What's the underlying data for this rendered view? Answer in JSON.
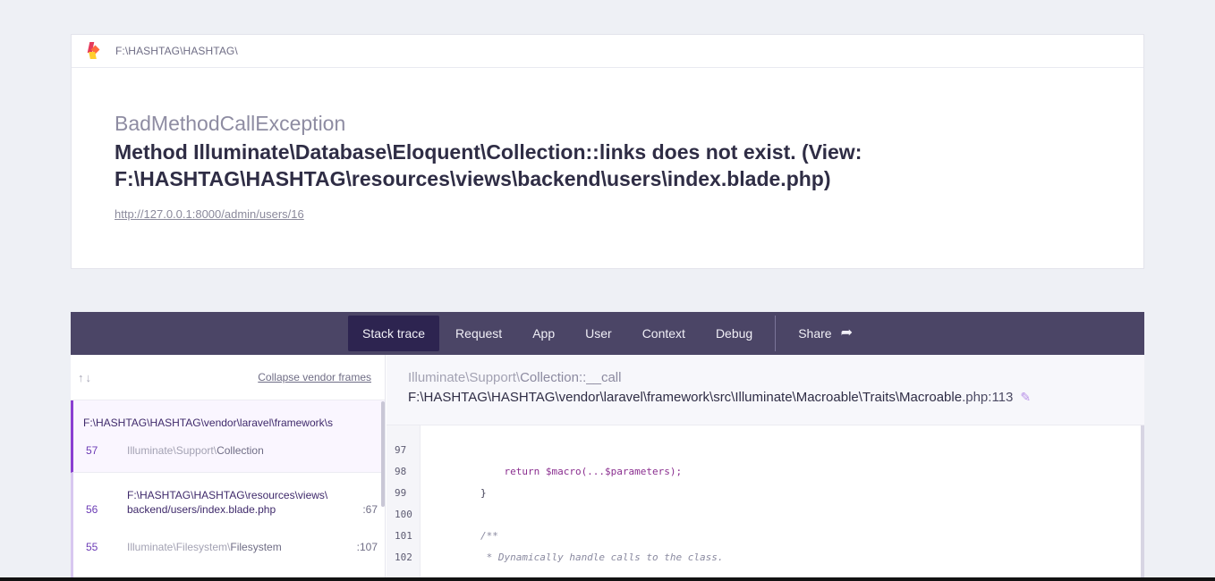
{
  "header": {
    "app_path": "F:\\HASHTAG\\HASHTAG\\",
    "exception_class": "BadMethodCallException",
    "exception_message": "Method Illuminate\\Database\\Eloquent\\Collection::links does not exist. (View: F:\\HASHTAG\\HASHTAG\\resources\\views\\backend\\users\\index.blade.php)",
    "url": "http://127.0.0.1:8000/admin/users/16"
  },
  "tabs": [
    {
      "label": "Stack trace"
    },
    {
      "label": "Request"
    },
    {
      "label": "App"
    },
    {
      "label": "User"
    },
    {
      "label": "Context"
    },
    {
      "label": "Debug"
    }
  ],
  "share_label": "Share",
  "frames_panel": {
    "arrows": "↑↓",
    "collapse_label": "Collapse vendor frames",
    "frames": [
      {
        "number": "57",
        "file": "F:\\HASHTAG\\HASHTAG\\vendor\\laravel\\framework\\s",
        "class_ns": "Illuminate\\Support\\",
        "class_name": "Collection",
        "line": ""
      },
      {
        "number": "56",
        "file_line1": "F:\\HASHTAG\\HASHTAG\\resources\\views\\",
        "file_line2": "backend/users/index.blade.php",
        "line": ":67"
      },
      {
        "number": "55",
        "class_ns": "Illuminate\\Filesystem\\",
        "class_name": "Filesystem",
        "line": ":107"
      }
    ]
  },
  "code_panel": {
    "class_ns": "Illuminate\\Support\\",
    "class_method": "Collection::__call",
    "file_path": "F:\\HASHTAG\\HASHTAG\\vendor\\laravel\\framework\\src\\Illuminate\\Macroable\\Traits\\Macroable",
    "file_ext_line": ".php:113",
    "lines": [
      {
        "n": "97",
        "code": ""
      },
      {
        "n": "98",
        "code": "            return $macro(...$parameters);"
      },
      {
        "n": "99",
        "code": "        }"
      },
      {
        "n": "100",
        "code": ""
      },
      {
        "n": "101",
        "code": "        /**"
      },
      {
        "n": "102",
        "code": "         * Dynamically handle calls to the class."
      }
    ]
  }
}
